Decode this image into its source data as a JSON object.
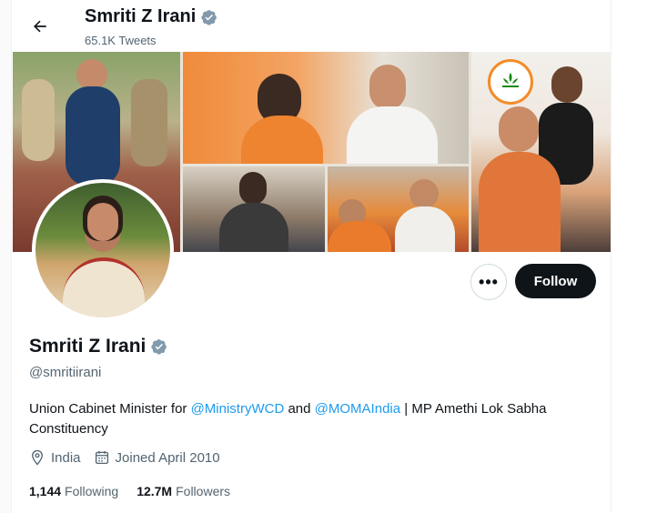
{
  "header": {
    "name": "Smriti Z Irani",
    "tweet_count": "65.1K Tweets"
  },
  "profile": {
    "name": "Smriti Z Irani",
    "handle": "@smritiirani",
    "bio": {
      "prefix": "Union Cabinet Minister for ",
      "mention1": "@MinistryWCD",
      "middle": " and ",
      "mention2": "@MOMAIndia",
      "suffix": " | MP Amethi Lok Sabha Constituency"
    },
    "location": "India",
    "joined": "Joined April 2010",
    "following_count": "1,144",
    "following_label": "Following",
    "followers_count": "12.7M",
    "followers_label": "Followers"
  },
  "actions": {
    "more_label": "•••",
    "follow_label": "Follow"
  },
  "icons": {
    "back": "arrow-left-icon",
    "verified": "verified-badge-icon",
    "location": "location-pin-icon",
    "calendar": "calendar-icon",
    "more": "more-horizontal-icon"
  },
  "colors": {
    "accent": "#1d9bf0",
    "text": "#0f1419",
    "muted": "#536471",
    "follow_bg": "#0f1419",
    "verified": "#829aab"
  }
}
